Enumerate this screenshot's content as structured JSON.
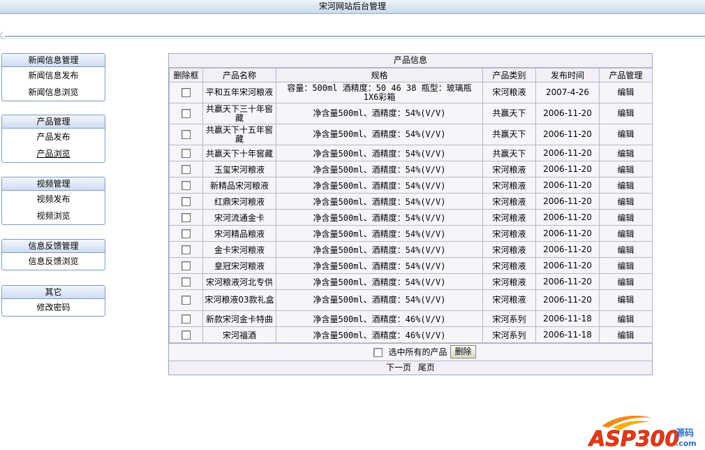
{
  "header": {
    "title": "宋河网站后台管理"
  },
  "sidebar": {
    "menus": [
      {
        "title": "新闻信息管理",
        "items": [
          "新闻信息发布",
          "新闻信息浏览"
        ]
      },
      {
        "title": "产品管理",
        "items": [
          "产品发布",
          "产品浏览"
        ]
      },
      {
        "title": "视频管理",
        "items": [
          "视频发布",
          "视频浏览"
        ]
      },
      {
        "title": "信息反馈管理",
        "items": [
          "信息反馈浏览"
        ]
      },
      {
        "title": "其它",
        "items": [
          "修改密码"
        ]
      }
    ]
  },
  "product_table": {
    "title": "产品信息",
    "columns": [
      "删除框",
      "产品名称",
      "规格",
      "产品类别",
      "发布时间",
      "产品管理"
    ],
    "rows": [
      {
        "name": "平和五年宋河粮液",
        "spec": "容量：500ml 酒精度：50 46 38 瓶型：玻璃瓶 1X6彩箱",
        "category": "宋河粮液",
        "date": "2007-4-26",
        "action": "编辑"
      },
      {
        "name": "共赢天下三十年窖藏",
        "spec": "净含量500ml、酒精度：54%(V/V)",
        "category": "共赢天下",
        "date": "2006-11-20",
        "action": "编辑"
      },
      {
        "name": "共赢天下十五年窖藏",
        "spec": "净含量500ml、酒精度：54%(V/V)",
        "category": "共赢天下",
        "date": "2006-11-20",
        "action": "编辑"
      },
      {
        "name": "共赢天下十年窖藏",
        "spec": "净含量500ml、酒精度：54%(V/V)",
        "category": "共赢天下",
        "date": "2006-11-20",
        "action": "编辑"
      },
      {
        "name": "玉玺宋河粮液",
        "spec": "净含量500ml、酒精度：54%(V/V)",
        "category": "宋河粮液",
        "date": "2006-11-20",
        "action": "编辑"
      },
      {
        "name": "新精品宋河粮液",
        "spec": "净含量500ml、酒精度：54%(V/V)",
        "category": "宋河粮液",
        "date": "2006-11-20",
        "action": "编辑"
      },
      {
        "name": "红鼎宋河粮液",
        "spec": "净含量500ml、酒精度：54%(V/V)",
        "category": "宋河粮液",
        "date": "2006-11-20",
        "action": "编辑"
      },
      {
        "name": "宋河流通金卡",
        "spec": "净含量500ml、酒精度：54%(V/V)",
        "category": "宋河粮液",
        "date": "2006-11-20",
        "action": "编辑"
      },
      {
        "name": "宋河精品粮液",
        "spec": "净含量500ml、酒精度：54%(V/V)",
        "category": "宋河粮液",
        "date": "2006-11-20",
        "action": "编辑"
      },
      {
        "name": "金卡宋河粮液",
        "spec": "净含量500ml、酒精度：54%(V/V)",
        "category": "宋河粮液",
        "date": "2006-11-20",
        "action": "编辑"
      },
      {
        "name": "皇冠宋河粮液",
        "spec": "净含量500ml、酒精度：54%(V/V)",
        "category": "宋河粮液",
        "date": "2006-11-20",
        "action": "编辑"
      },
      {
        "name": "宋河粮液河北专供",
        "spec": "净含量500ml、酒精度：54%(V/V)",
        "category": "宋河粮液",
        "date": "2006-11-20",
        "action": "编辑"
      },
      {
        "name": "宋河粮液03款礼盒",
        "spec": "净含量500ml、酒精度：54%(V/V)",
        "category": "宋河粮液",
        "date": "2006-11-20",
        "action": "编辑"
      },
      {
        "name": "新款宋河金卡特曲",
        "spec": "净含量500ml、酒精度：46%(V/V)",
        "category": "宋河系列",
        "date": "2006-11-18",
        "action": "编辑"
      },
      {
        "name": "宋河福酒",
        "spec": "净含量500ml、酒精度：46%(V/V)",
        "category": "宋河系列",
        "date": "2006-11-18",
        "action": "编辑"
      }
    ],
    "select_all_label": "选中所有的产品",
    "delete_label": "删除",
    "pager": {
      "next": "下一页",
      "last": "尾页"
    }
  },
  "watermark": {
    "text": "ASP300",
    "suffix_cn": "源码",
    "suffix_domain": ".com"
  }
}
